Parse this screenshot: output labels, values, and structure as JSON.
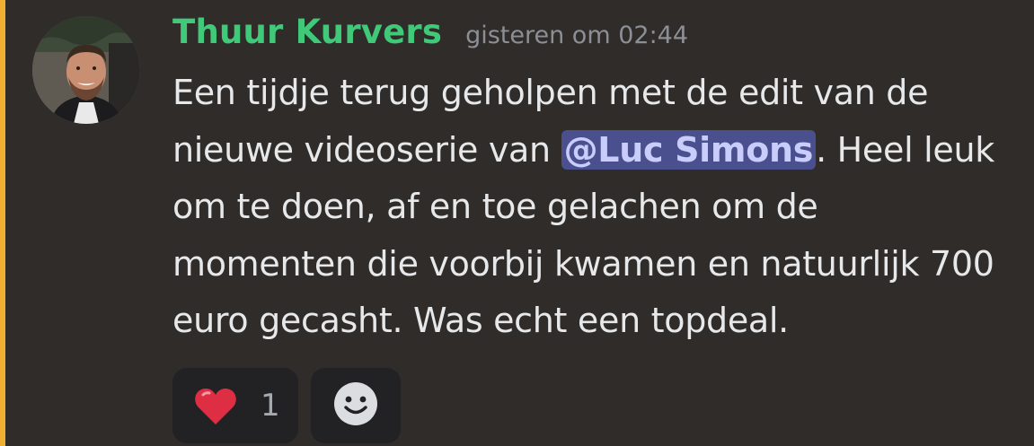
{
  "message": {
    "author": "Thuur Kurvers",
    "timestamp": "gisteren om 02:44",
    "text_before_mention": "Een tijdje terug geholpen met de edit van de nieuwe videoserie van ",
    "mention": "@Luc Simons",
    "text_after_mention": ". Heel leuk om te doen, af en toe gelachen om de momenten die voorbij kwamen en natuurlijk 700 euro gecasht. Was echt een topdeal."
  },
  "reactions": [
    {
      "emoji": "heart-icon",
      "count": "1"
    }
  ],
  "add_reaction": {
    "icon": "smiley-icon"
  },
  "colors": {
    "background": "#2f2c2a",
    "highlight_bar": "#f0b132",
    "username": "#3fc979",
    "timestamp": "#8c8f96",
    "text": "#e7e8ea",
    "mention_bg": "#4a4f8e",
    "mention_text": "#c9cdfb",
    "reaction_bg": "#222124"
  }
}
